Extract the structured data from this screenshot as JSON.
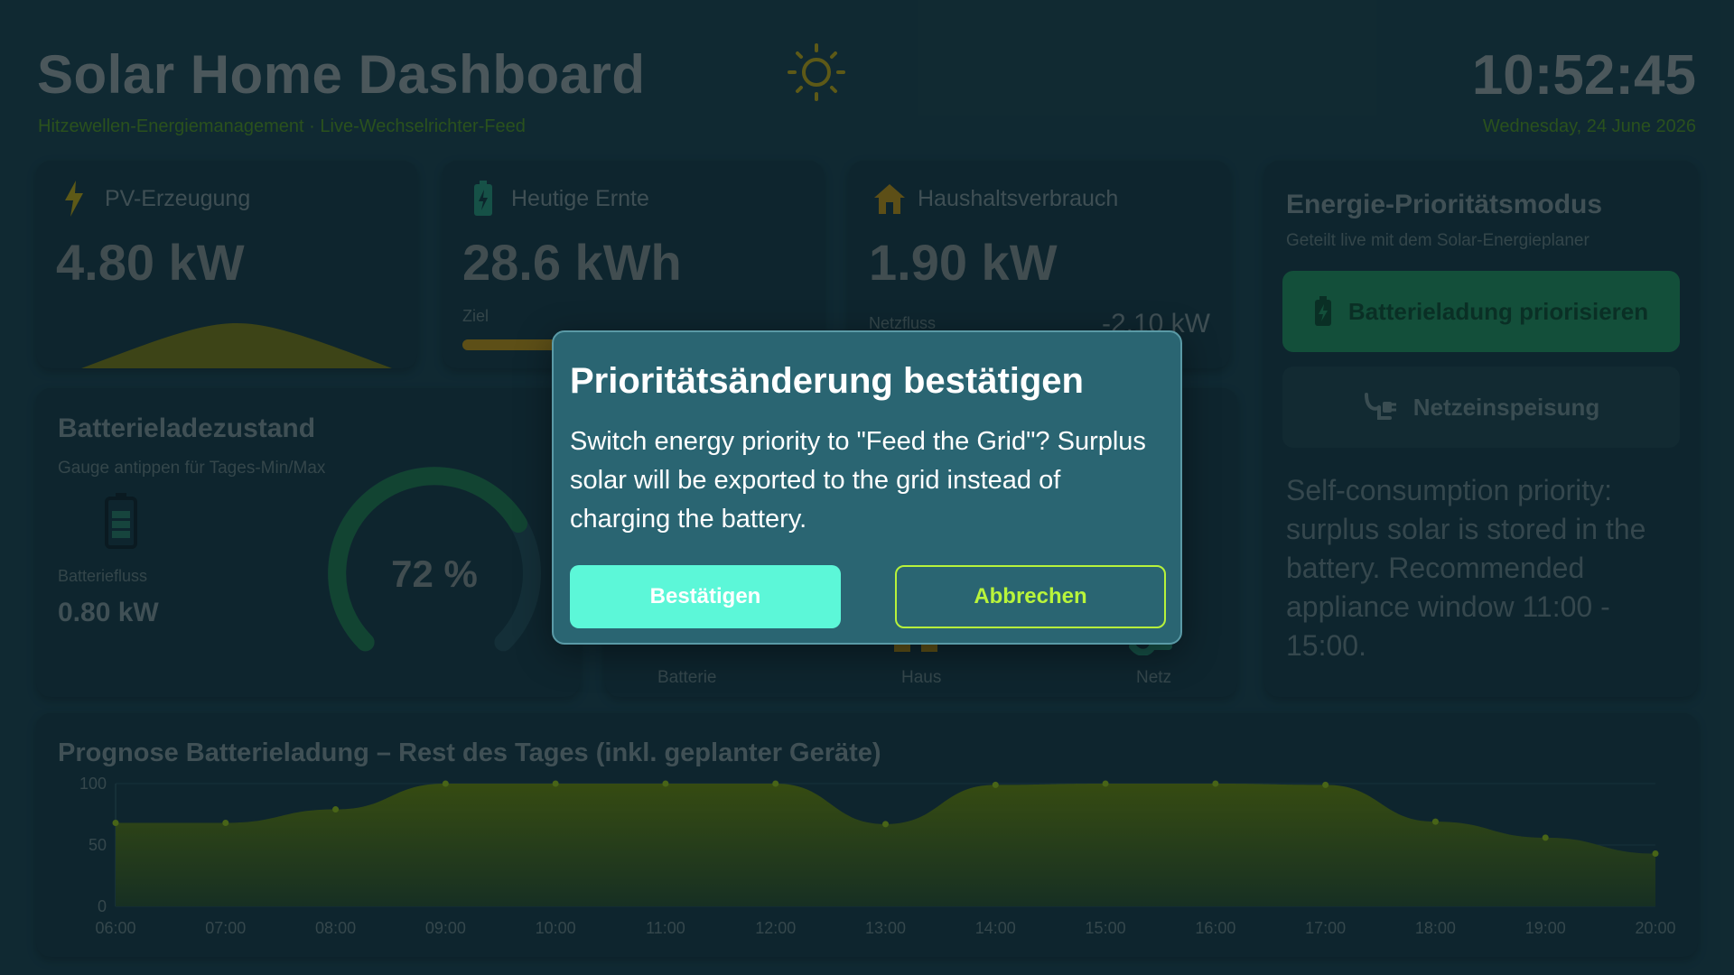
{
  "header": {
    "title": "Solar Home Dashboard",
    "subtitle": "Hitzewellen-Energiemanagement · Live-Wechselrichter-Feed",
    "time": "10:52:45",
    "date": "Wednesday, 24 June 2026",
    "sun_icon": "sun-icon"
  },
  "cards": {
    "pv": {
      "label": "PV-Erzeugung",
      "value": "4.80 kW",
      "icon": "lightning-icon"
    },
    "harvest": {
      "label": "Heutige Ernte",
      "value": "28.6 kWh",
      "goal_label": "Ziel",
      "icon": "battery-charging-icon"
    },
    "consumption": {
      "label": "Haushaltsverbrauch",
      "value": "1.90 kW",
      "grid_label": "Netzfluss",
      "grid_value": "-2.10 kW",
      "icon": "house-icon"
    }
  },
  "battery": {
    "title": "Batterieladezustand",
    "subtitle": "Gauge antippen für Tages-Min/Max",
    "flow_label": "Batteriefluss",
    "flow_value": "0.80 kW",
    "percent_label": "72 %",
    "percent": 72
  },
  "flow": {
    "labels": [
      "Batterie",
      "Haus",
      "Netz"
    ]
  },
  "priority": {
    "title": "Energie-Prioritätsmodus",
    "subtitle": "Geteilt live mit dem Solar-Energieplaner",
    "btn_battery": "Batterieladung priorisieren",
    "btn_grid": "Netzeinspeisung",
    "description": "Self-consumption priority: surplus solar is stored in the battery. Recommended appliance window 11:00 - 15:00."
  },
  "modal": {
    "title": "Prioritätsänderung bestätigen",
    "body": "Switch energy priority to \"Feed the Grid\"? Surplus solar will be exported to the grid instead of charging the battery.",
    "confirm": "Bestätigen",
    "cancel": "Abbrechen"
  },
  "chart_data": {
    "type": "area",
    "title": "Prognose Batterieladung – Rest des Tages (inkl. geplanter Geräte)",
    "x": [
      "06:00",
      "07:00",
      "08:00",
      "09:00",
      "10:00",
      "11:00",
      "12:00",
      "13:00",
      "14:00",
      "15:00",
      "16:00",
      "17:00",
      "18:00",
      "19:00",
      "20:00"
    ],
    "values": [
      68,
      68,
      79,
      100,
      100,
      100,
      100,
      67,
      99,
      100,
      100,
      99,
      69,
      56,
      43
    ],
    "ylim": [
      0,
      100
    ],
    "yticks": [
      0,
      50,
      100
    ],
    "color": "#6b8a10"
  }
}
